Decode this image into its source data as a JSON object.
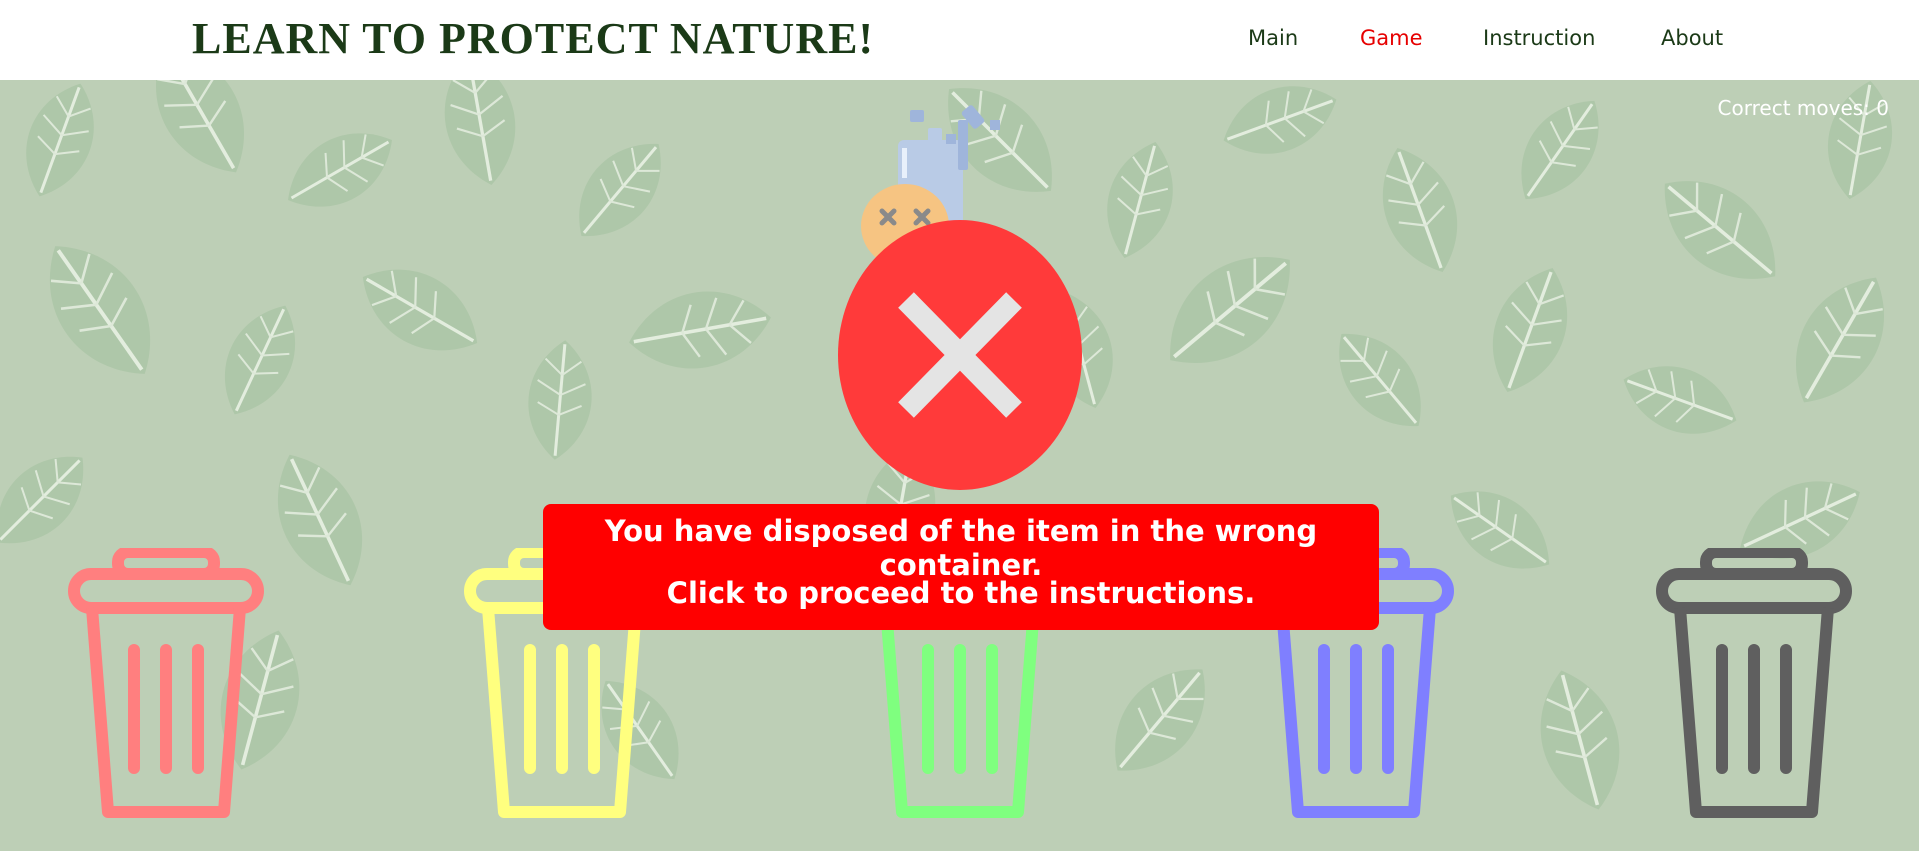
{
  "header": {
    "title": "LEARN TO PROTECT NATURE!",
    "nav": [
      {
        "label": "Main",
        "active": false
      },
      {
        "label": "Game",
        "active": true
      },
      {
        "label": "Instruction",
        "active": false
      },
      {
        "label": "About",
        "active": false
      }
    ]
  },
  "game": {
    "score_text": "Correct moves: 0",
    "item_icon": "trash-item-icon",
    "bins": [
      {
        "color": "#ff7f7f",
        "icon": "red-bin-icon"
      },
      {
        "color": "#ffff7f",
        "icon": "yellow-bin-icon"
      },
      {
        "color": "#7fff7f",
        "icon": "green-bin-icon"
      },
      {
        "color": "#7f7fff",
        "icon": "blue-bin-icon"
      },
      {
        "color": "#5f5f5f",
        "icon": "black-bin-icon"
      }
    ]
  },
  "feedback": {
    "icon": "wrong-x-icon",
    "color": "#ff3a3a",
    "message_line1": "You have disposed of the item in the wrong container.",
    "message_line2": "Click to proceed to the instructions."
  }
}
